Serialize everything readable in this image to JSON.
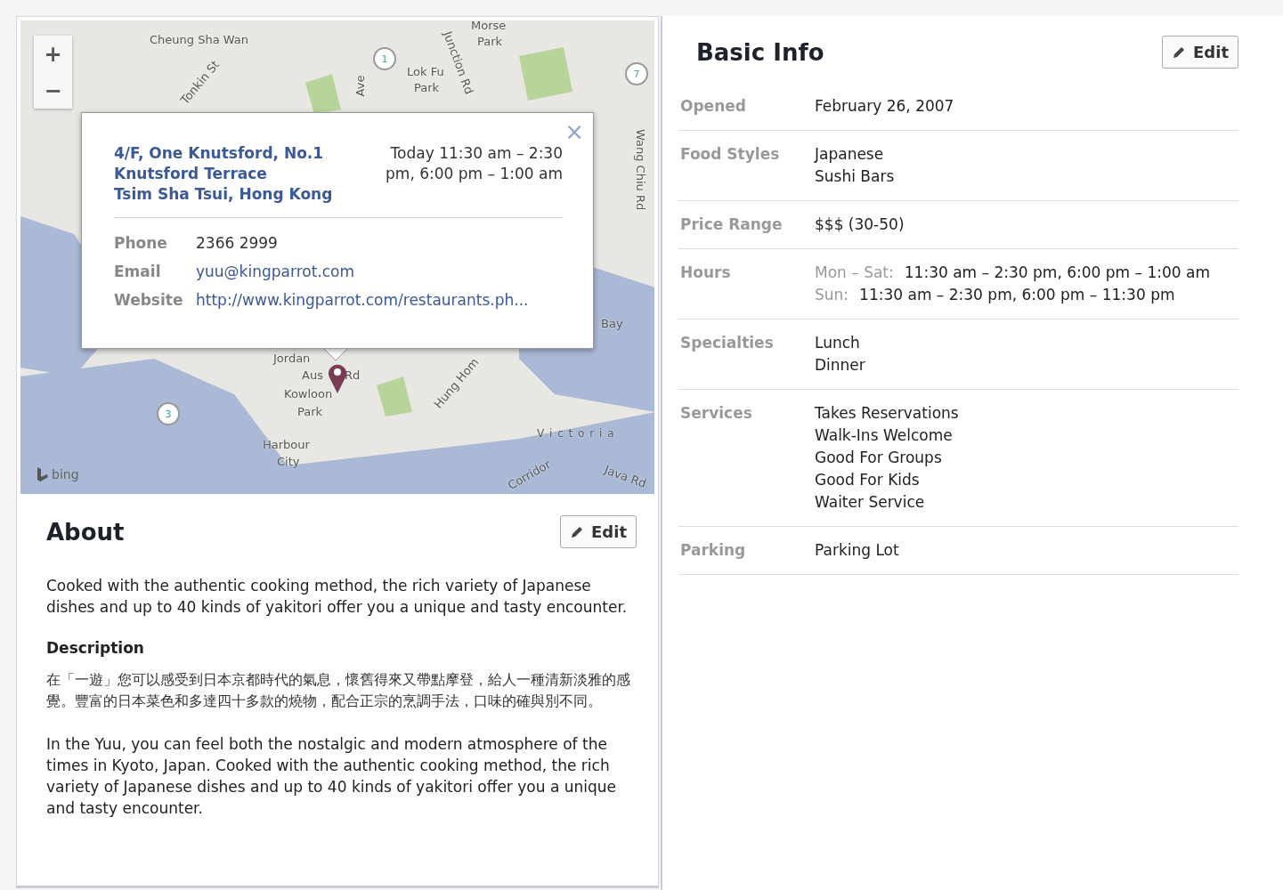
{
  "map": {
    "zoom_controls": [
      "+",
      "−"
    ],
    "labels": [
      "Cheung Sha Wan",
      "Tonkin St",
      "Morse",
      "Park",
      "Lok Fu",
      "Park",
      "Junction Rd",
      "Ave",
      "Wang Chiu Rd",
      "Bay",
      "Jordan",
      "Aus",
      "Rd",
      "Kowloon",
      "Park",
      "Hung Hom",
      "Harbour",
      "City",
      "V i c t o r i a",
      "Corridor",
      "Java Rd"
    ],
    "route_markers": [
      "1",
      "7",
      "3"
    ],
    "attribution": "bing",
    "popup": {
      "close": "×",
      "address_lines": [
        "4/F, One Knutsford, No.1",
        "Knutsford Terrace",
        "Tsim Sha Tsui, Hong Kong"
      ],
      "hours": "Today 11:30 am – 2:30 pm, 6:00 pm – 1:00 am",
      "contacts": [
        {
          "label": "Phone",
          "value": "2366 2999",
          "kind": "text"
        },
        {
          "label": "Email",
          "value": "yuu@kingparrot.com",
          "kind": "link"
        },
        {
          "label": "Website",
          "value": "http://www.kingparrot.com/restaurants.ph...",
          "kind": "link"
        }
      ]
    }
  },
  "about": {
    "title": "About",
    "edit": "Edit",
    "summary": "Cooked with the authentic cooking method, the rich variety of Japanese dishes and up to 40 kinds of yakitori offer you a unique and tasty encounter.",
    "description_heading": "Description",
    "paragraphs": [
      "在「一遊」您可以感受到日本京都時代的氣息，懷舊得來又帶點摩登，給人一種清新淡雅的感覺。豐富的日本菜色和多達四十多款的燒物，配合正宗的烹調手法，口味的確與別不同。",
      "In the Yuu, you can feel both the nostalgic and modern atmosphere of the times in Kyoto, Japan. Cooked with the authentic cooking method, the rich variety of Japanese dishes and up to 40 kinds of yakitori offer you a unique and tasty encounter."
    ]
  },
  "basic_info": {
    "title": "Basic Info",
    "edit": "Edit",
    "rows": [
      {
        "label": "Opened",
        "kind": "list",
        "values": [
          "February 26, 2007"
        ]
      },
      {
        "label": "Food Styles",
        "kind": "list",
        "values": [
          "Japanese",
          "Sushi Bars"
        ]
      },
      {
        "label": "Price Range",
        "kind": "list",
        "values": [
          "$$$ (30-50)"
        ]
      },
      {
        "label": "Hours",
        "kind": "hours",
        "entries": [
          {
            "day": "Mon – Sat:",
            "time": "11:30 am – 2:30 pm, 6:00 pm – 1:00 am"
          },
          {
            "day": "Sun:",
            "time": "11:30 am – 2:30 pm, 6:00 pm – 11:30 pm"
          }
        ]
      },
      {
        "label": "Specialties",
        "kind": "list",
        "values": [
          "Lunch",
          "Dinner"
        ]
      },
      {
        "label": "Services",
        "kind": "list",
        "values": [
          "Takes Reservations",
          "Walk-Ins Welcome",
          "Good For Groups",
          "Good For Kids",
          "Waiter Service"
        ]
      },
      {
        "label": "Parking",
        "kind": "list",
        "values": [
          "Parking Lot"
        ]
      }
    ]
  }
}
